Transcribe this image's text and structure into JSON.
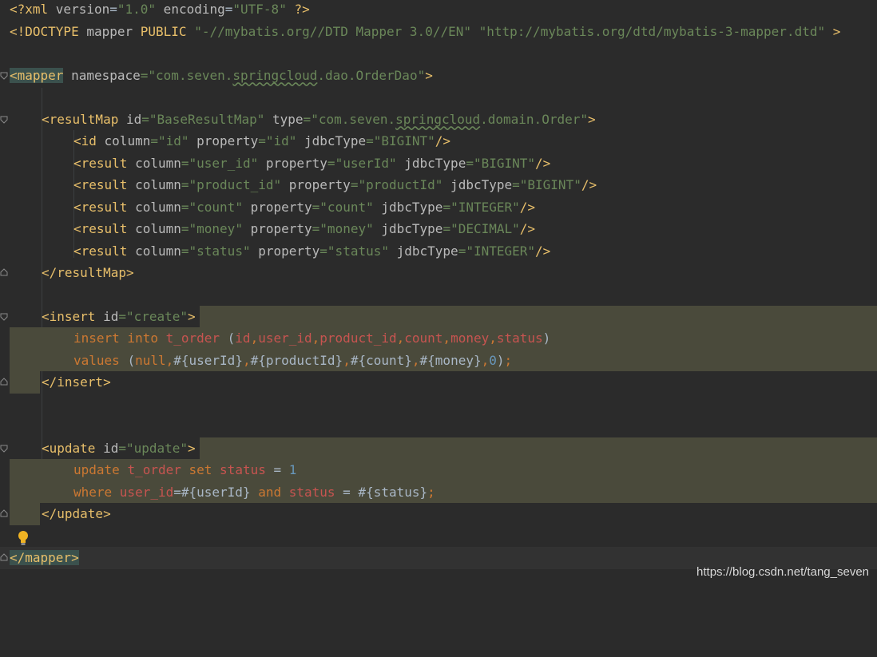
{
  "lines": {
    "l1": {
      "p1": "<?xml ",
      "a1": "version",
      "e1": "=",
      "v1": "\"1.0\"",
      "a2": " encoding",
      "e2": "=",
      "v2": "\"UTF-8\"",
      "p2": " ?>"
    },
    "l2": {
      "p1": "<!DOCTYPE ",
      "t1": "mapper ",
      "k1": "PUBLIC ",
      "v1": "\"-//mybatis.org//DTD Mapper 3.0//EN\"",
      "sp": " ",
      "v2": "\"http://mybatis.org/dtd/mybatis-3-mapper.dtd\"",
      "p2": " >"
    },
    "l4": {
      "t1": "<mapper",
      "a1": " namespace",
      "e1": "=",
      "v1a": "\"com.seven.",
      "v1b": "springcloud",
      "v1c": ".dao.OrderDao\"",
      "t2": ">"
    },
    "l6": {
      "t1": "<resultMap",
      "a1": " id",
      "e1": "=",
      "v1": "\"BaseResultMap\"",
      "a2": " type",
      "e2": "=",
      "v2a": "\"com.seven.",
      "v2b": "springcloud",
      "v2c": ".domain.Order\"",
      "t2": ">"
    },
    "l7": {
      "t1": "<id",
      "a1": " column",
      "e1": "=",
      "v1": "\"id\"",
      "a2": " property",
      "e2": "=",
      "v2": "\"id\"",
      "a3": " jdbcType",
      "e3": "=",
      "v3": "\"BIGINT\"",
      "t2": "/>"
    },
    "l8": {
      "t1": "<result",
      "a1": " column",
      "e1": "=",
      "v1": "\"user_id\"",
      "a2": " property",
      "e2": "=",
      "v2": "\"userId\"",
      "a3": " jdbcType",
      "e3": "=",
      "v3": "\"BIGINT\"",
      "t2": "/>"
    },
    "l9": {
      "t1": "<result",
      "a1": " column",
      "e1": "=",
      "v1": "\"product_id\"",
      "a2": " property",
      "e2": "=",
      "v2": "\"productId\"",
      "a3": " jdbcType",
      "e3": "=",
      "v3": "\"BIGINT\"",
      "t2": "/>"
    },
    "l10": {
      "t1": "<result",
      "a1": " column",
      "e1": "=",
      "v1": "\"count\"",
      "a2": " property",
      "e2": "=",
      "v2": "\"count\"",
      "a3": " jdbcType",
      "e3": "=",
      "v3": "\"INTEGER\"",
      "t2": "/>"
    },
    "l11": {
      "t1": "<result",
      "a1": " column",
      "e1": "=",
      "v1": "\"money\"",
      "a2": " property",
      "e2": "=",
      "v2": "\"money\"",
      "a3": " jdbcType",
      "e3": "=",
      "v3": "\"DECIMAL\"",
      "t2": "/>"
    },
    "l12": {
      "t1": "<result",
      "a1": " column",
      "e1": "=",
      "v1": "\"status\"",
      "a2": " property",
      "e2": "=",
      "v2": "\"status\"",
      "a3": " jdbcType",
      "e3": "=",
      "v3": "\"INTEGER\"",
      "t2": "/>"
    },
    "l13": {
      "t1": "</resultMap>"
    },
    "l15": {
      "t1": "<insert",
      "a1": " id",
      "e1": "=",
      "v1": "\"create\"",
      "t2": ">"
    },
    "l16": {
      "k1": "insert into ",
      "r1": "t_order",
      "p1": " (",
      "c1": "id",
      "k2": ",",
      "c2": "user_id",
      "k3": ",",
      "c3": "product_id",
      "k4": ",",
      "c4": "count",
      "k5": ",",
      "c5": "money",
      "k6": ",",
      "c6": "status",
      "p2": ")"
    },
    "l17": {
      "k1": "values ",
      "p1": "(",
      "k2": "null",
      "k3": ",",
      "p2": "#{userId}",
      "k4": ",",
      "p3": "#{productId}",
      "k5": ",",
      "p4": "#{count}",
      "k6": ",",
      "p5": "#{money}",
      "k7": ",",
      "n1": "0",
      "p6": ")",
      "k8": ";"
    },
    "l18": {
      "t1": "</insert>"
    },
    "l21": {
      "t1": "<update",
      "a1": " id",
      "e1": "=",
      "v1": "\"update\"",
      "t2": ">"
    },
    "l22": {
      "k1": "update ",
      "r1": "t_order",
      "k2": " set ",
      "r2": "status",
      "p1": " = ",
      "n1": "1"
    },
    "l23": {
      "k1": "where ",
      "r1": "user_id",
      "p1": "=#{userId} ",
      "k2": "and ",
      "r2": "status",
      "p2": " = #{status}",
      "k3": ";"
    },
    "l24": {
      "t1": "</update>"
    },
    "l26": {
      "t1": "</mapper",
      "t2": ">"
    }
  },
  "watermark": "https://blog.csdn.net/tang_seven",
  "colors": {
    "background": "#2b2b2b",
    "tag": "#e8bf6a",
    "string": "#6a8759",
    "keyword": "#cc7832",
    "injected_sql_bg": "#4a4a3b"
  },
  "icons": {
    "intention": "lightbulb-icon"
  }
}
